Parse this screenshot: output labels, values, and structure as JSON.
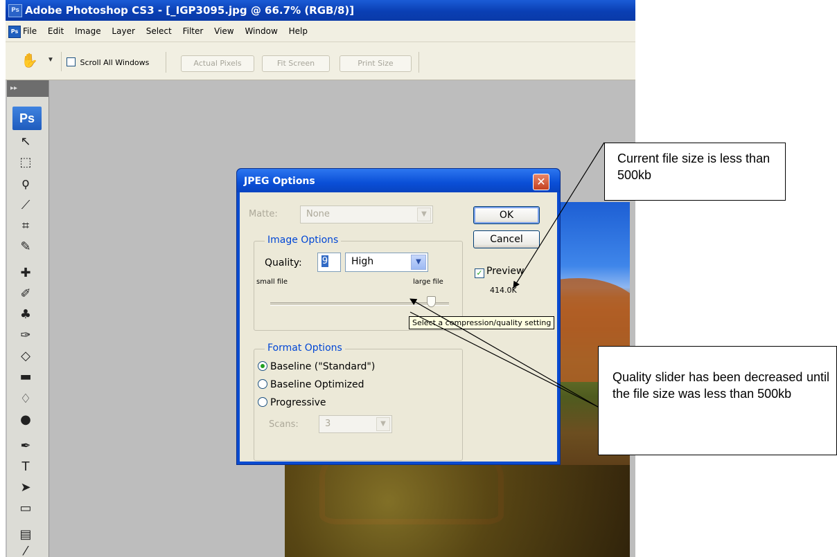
{
  "window": {
    "title": "Adobe Photoshop CS3 - [_IGP3095.jpg @ 66.7% (RGB/8)]",
    "icon": "ps-logo-icon"
  },
  "menubar": {
    "items": [
      "File",
      "Edit",
      "Image",
      "Layer",
      "Select",
      "Filter",
      "View",
      "Window",
      "Help"
    ]
  },
  "options_bar": {
    "tool_icon": "hand-icon",
    "scroll_all_windows_label": "Scroll All Windows",
    "scroll_all_windows_checked": false,
    "buttons": [
      "Actual Pixels",
      "Fit Screen",
      "Print Size"
    ]
  },
  "toolbox": {
    "badge": "Ps"
  },
  "dialog": {
    "title": "JPEG Options",
    "matte_label": "Matte:",
    "matte_value": "None",
    "image_options_title": "Image Options",
    "quality_label": "Quality:",
    "quality_value": "9",
    "quality_preset": "High",
    "small_file_label": "small file",
    "large_file_label": "large file",
    "quality_slider_fraction": 0.9,
    "tooltip": "Select a compression/quality setting",
    "format_options_title": "Format Options",
    "format_options": [
      {
        "label": "Baseline (\"Standard\")",
        "selected": true
      },
      {
        "label": "Baseline Optimized",
        "selected": false
      },
      {
        "label": "Progressive",
        "selected": false
      }
    ],
    "scans_label": "Scans:",
    "scans_value": "3",
    "ok_label": "OK",
    "cancel_label": "Cancel",
    "preview_label": "Preview",
    "preview_checked": true,
    "file_size": "414.0K"
  },
  "callouts": {
    "file_size_note": "Current file size is less than 500kb",
    "quality_note": "Quality slider has been decreased until the file size was less than 500kb"
  },
  "colors": {
    "titlebar_blue": "#0a3fb4",
    "dialog_blue": "#0a4bd0",
    "ps_gray": "#bdbdbd"
  }
}
